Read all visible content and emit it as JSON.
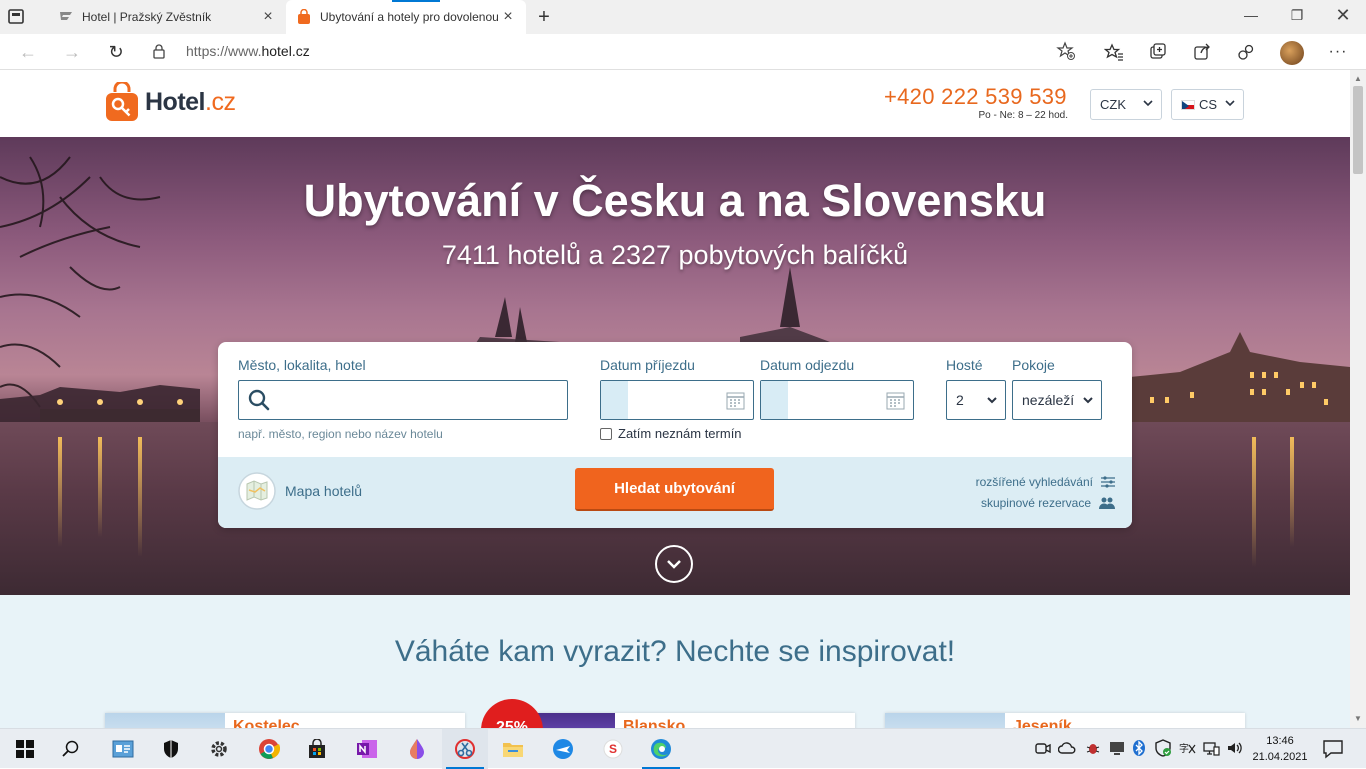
{
  "browser": {
    "tabs": [
      {
        "title": "Hotel | Pražský Zvěstník",
        "active": false
      },
      {
        "title": "Ubytování a hotely pro dovolenou",
        "active": true
      }
    ],
    "url_prefix": "https://www.",
    "url_domain": "hotel.cz",
    "accent_color": "#0078d4"
  },
  "header": {
    "logo_main": "Hotel",
    "logo_tld": ".cz",
    "phone": "+420 222 539 539",
    "hours": "Po - Ne: 8 – 22 hod.",
    "currency": "CZK",
    "language": "CS",
    "brand_color": "#f06a1f"
  },
  "hero": {
    "title": "Ubytování v Česku a na Slovensku",
    "subtitle": "7411 hotelů a 2327 pobytových balíčků"
  },
  "search": {
    "location_label": "Město, lokalita, hotel",
    "location_value": "",
    "location_hint": "např. město, region nebo název hotelu",
    "arrival_label": "Datum příjezdu",
    "departure_label": "Datum odjezdu",
    "unknown_date_label": "Zatím neznám termín",
    "unknown_date_checked": false,
    "guests_label": "Hosté",
    "guests_value": "2",
    "rooms_label": "Pokoje",
    "rooms_value": "nezáleží",
    "map_link": "Mapa hotelů",
    "search_button": "Hledat ubytování",
    "advanced_link": "rozšířené vyhledávání",
    "group_link": "skupinové rezervace"
  },
  "inspire": {
    "heading": "Váháte kam vyrazit? Nechte se inspirovat!",
    "cards": [
      {
        "name": "Kostelec"
      },
      {
        "name": "Blansko"
      },
      {
        "name": "Jeseník"
      }
    ],
    "badge": "25%"
  },
  "taskbar": {
    "time": "13:46",
    "date": "21.04.2021"
  }
}
